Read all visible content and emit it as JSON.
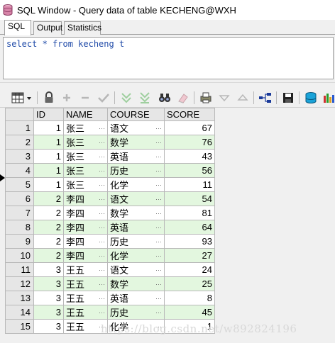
{
  "window": {
    "title": "SQL Window - Query data of table KECHENG@WXH"
  },
  "tabs": [
    {
      "label": "SQL",
      "active": true
    },
    {
      "label": "Output",
      "active": false
    },
    {
      "label": "Statistics",
      "active": false
    }
  ],
  "editor": {
    "sql": "select * from kecheng t"
  },
  "grid": {
    "columns": [
      "ID",
      "NAME",
      "COURSE",
      "SCORE"
    ],
    "current_row": 5,
    "rows": [
      {
        "rn": "1",
        "id": "1",
        "name": "张三",
        "course": "语文",
        "score": "67"
      },
      {
        "rn": "2",
        "id": "1",
        "name": "张三",
        "course": "数学",
        "score": "76"
      },
      {
        "rn": "3",
        "id": "1",
        "name": "张三",
        "course": "英语",
        "score": "43"
      },
      {
        "rn": "4",
        "id": "1",
        "name": "张三",
        "course": "历史",
        "score": "56"
      },
      {
        "rn": "5",
        "id": "1",
        "name": "张三",
        "course": "化学",
        "score": "11"
      },
      {
        "rn": "6",
        "id": "2",
        "name": "李四",
        "course": "语文",
        "score": "54"
      },
      {
        "rn": "7",
        "id": "2",
        "name": "李四",
        "course": "数学",
        "score": "81"
      },
      {
        "rn": "8",
        "id": "2",
        "name": "李四",
        "course": "英语",
        "score": "64"
      },
      {
        "rn": "9",
        "id": "2",
        "name": "李四",
        "course": "历史",
        "score": "93"
      },
      {
        "rn": "10",
        "id": "2",
        "name": "李四",
        "course": "化学",
        "score": "27"
      },
      {
        "rn": "11",
        "id": "3",
        "name": "王五",
        "course": "语文",
        "score": "24"
      },
      {
        "rn": "12",
        "id": "3",
        "name": "王五",
        "course": "数学",
        "score": "25"
      },
      {
        "rn": "13",
        "id": "3",
        "name": "王五",
        "course": "英语",
        "score": "8"
      },
      {
        "rn": "14",
        "id": "3",
        "name": "王五",
        "course": "历史",
        "score": "45"
      },
      {
        "rn": "15",
        "id": "3",
        "name": "王五",
        "course": "化学",
        "score": "1"
      }
    ],
    "ellipsis": "···"
  },
  "toolbar_icons": [
    "grid-options-icon",
    "lock-icon",
    "add-record-icon",
    "delete-record-icon",
    "post-changes-icon",
    "fetch-next-icon",
    "fetch-last-icon",
    "query-by-example-icon",
    "clear-record-icon",
    "print-icon",
    "filter-icon",
    "previous-icon",
    "next-icon",
    "single-record-view-icon",
    "save-icon",
    "export-icon",
    "chart-icon"
  ],
  "colors": {
    "even_row": "#e3f7df",
    "header": "#e6e6e6",
    "sql_text": "#1f4aa8"
  },
  "watermark": "https://blog.csdn.net/w892824196"
}
